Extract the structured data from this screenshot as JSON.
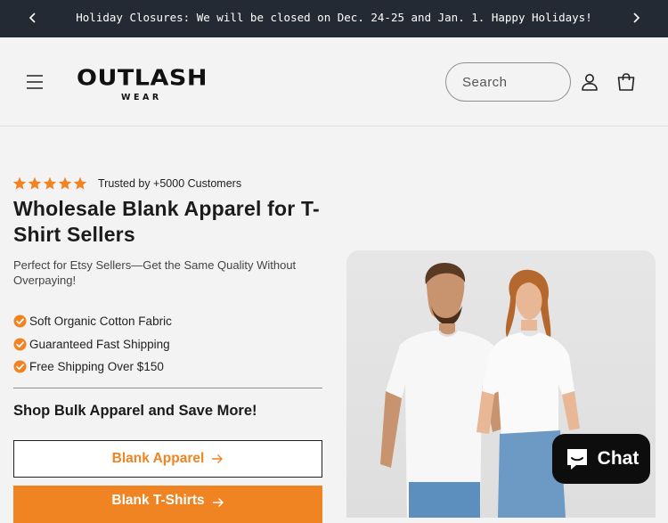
{
  "announcement": {
    "message": "Holiday Closures: We will be closed on Dec. 24-25 and Jan. 1. Happy Holidays!"
  },
  "header": {
    "logo_text": "OUTLASH",
    "logo_subtext": "WEAR",
    "search_placeholder": "Search",
    "icons": [
      "hamburger-menu-icon",
      "search-field",
      "account-icon",
      "cart-icon"
    ]
  },
  "hero": {
    "rating_stars": 5,
    "rating_text": "Trusted by +5000 Customers",
    "title": "Wholesale Blank Apparel for T-Shirt Sellers",
    "subtitle": "Perfect for Etsy Sellers—Get the Same Quality Without Overpaying!",
    "benefits": [
      "Soft Organic Cotton Fabric",
      "Guaranteed Fast Shipping",
      "Free Shipping Over $150"
    ],
    "cta_heading": "Shop Bulk Apparel and Save More!",
    "buttons": {
      "primary_outline": "Blank Apparel",
      "primary_solid": "Blank T-Shirts"
    }
  },
  "chat": {
    "label": "Chat"
  },
  "colors": {
    "accent": "#f08423",
    "announcement_bg": "#232a33",
    "page_bg": "#f3f3f3",
    "chat_bg": "#0d0d0d"
  }
}
